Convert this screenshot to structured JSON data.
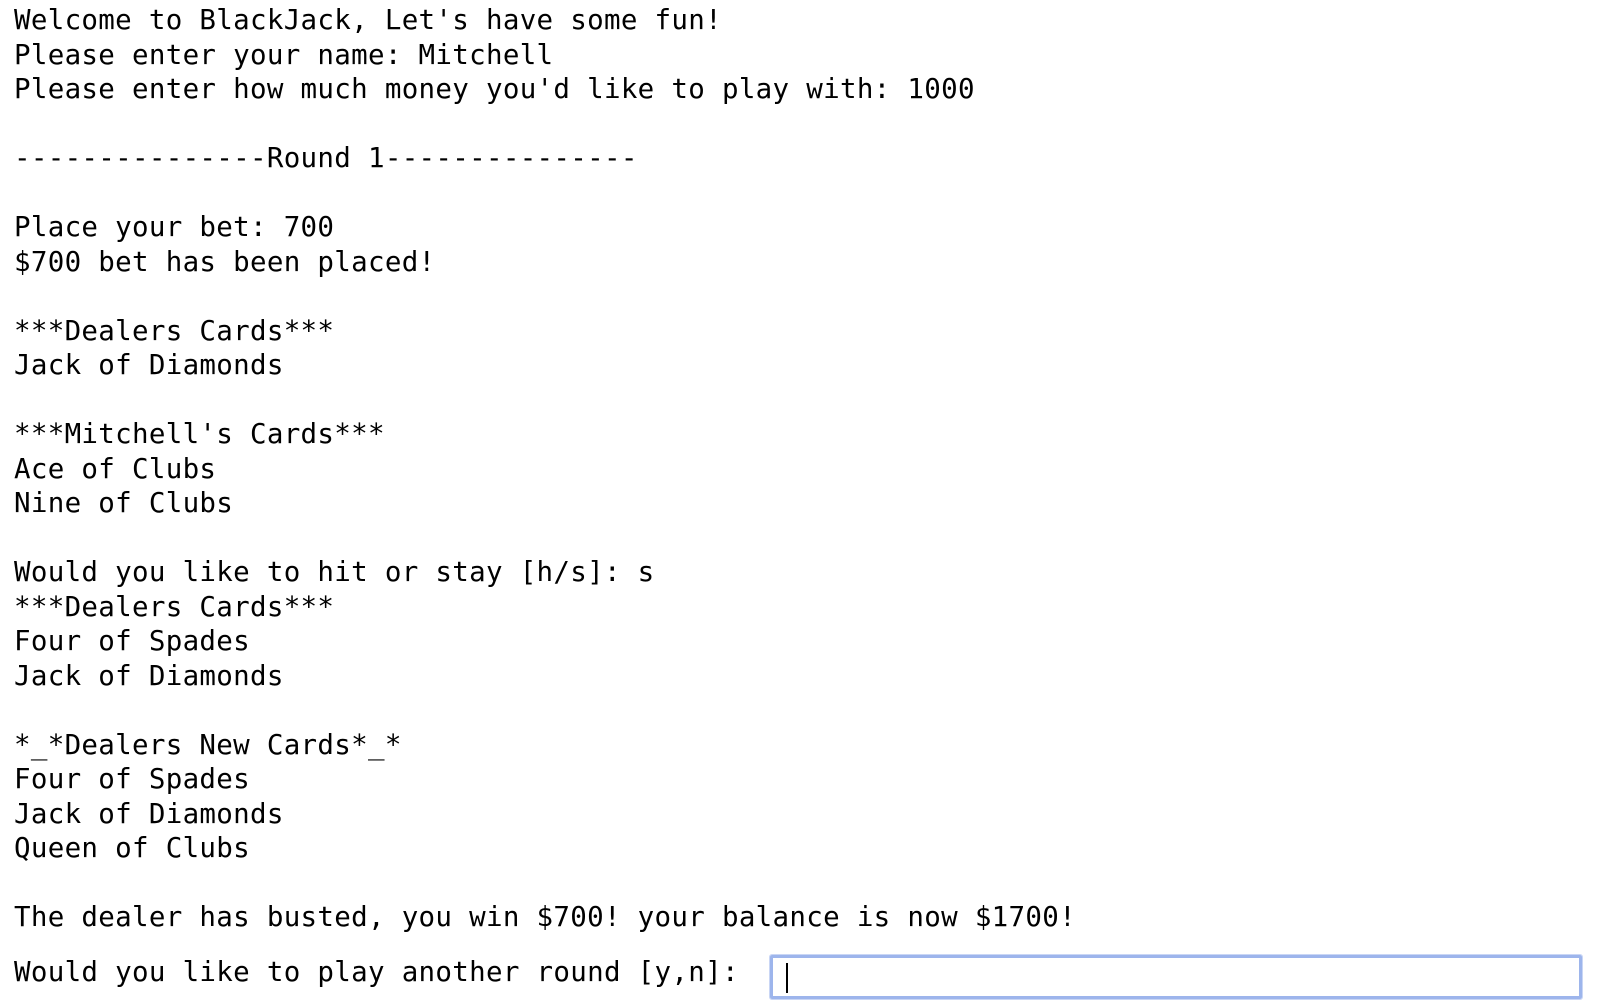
{
  "console": {
    "lines": [
      "Welcome to BlackJack, Let's have some fun!",
      "Please enter your name: Mitchell",
      "Please enter how much money you'd like to play with: 1000",
      "",
      "---------------Round 1---------------",
      "",
      "Place your bet: 700",
      "$700 bet has been placed!",
      "",
      "***Dealers Cards***",
      "Jack of Diamonds",
      "",
      "***Mitchell's Cards***",
      "Ace of Clubs",
      "Nine of Clubs",
      "",
      "Would you like to hit or stay [h/s]: s",
      "***Dealers Cards***",
      "Four of Spades",
      "Jack of Diamonds",
      "",
      "*_*Dealers New Cards*_*",
      "Four of Spades",
      "Jack of Diamonds",
      "Queen of Clubs",
      "",
      "The dealer has busted, you win $700! your balance is now $1700!"
    ]
  },
  "prompt": {
    "label": "Would you like to play another round [y,n]: ",
    "value": ""
  },
  "colors": {
    "text": "#000000",
    "background": "#ffffff",
    "input_focus_border": "#9db5ec"
  }
}
